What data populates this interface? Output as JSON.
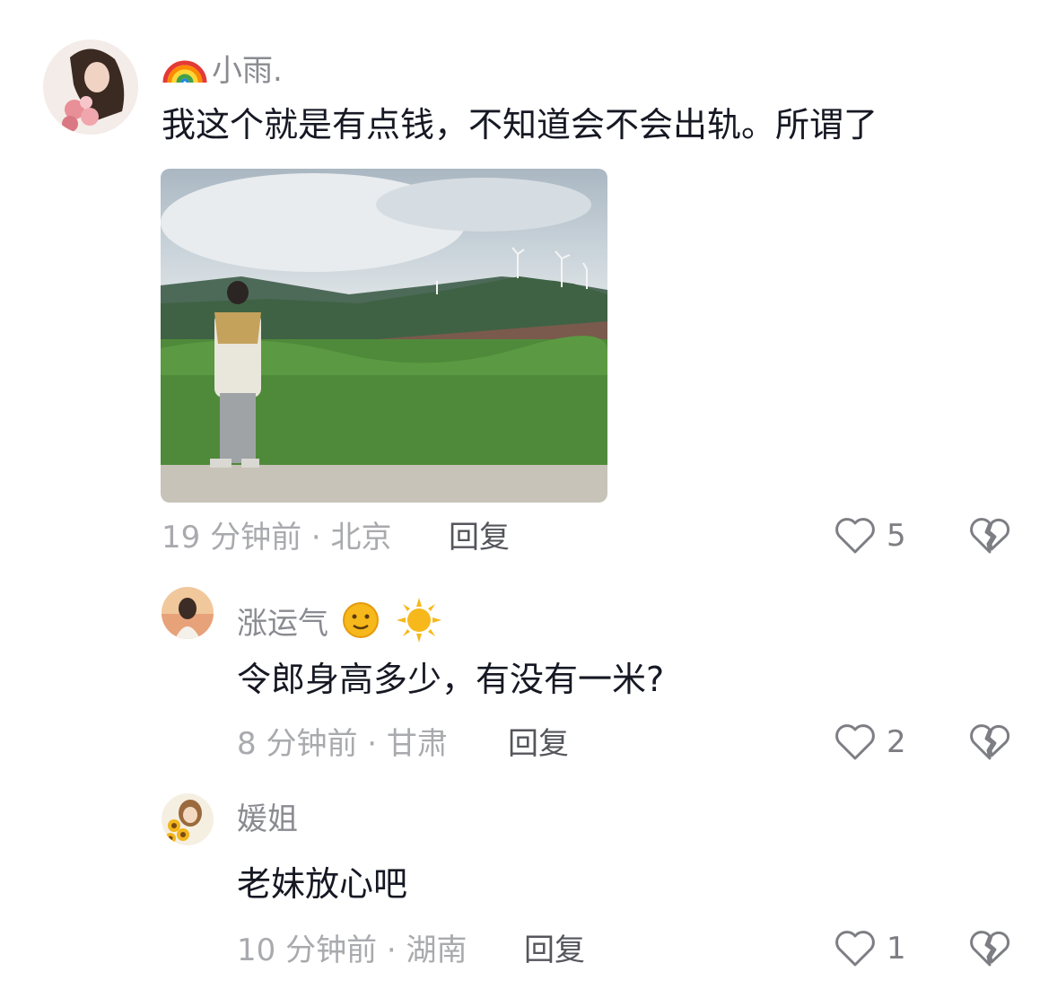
{
  "comments": [
    {
      "name_prefix_icon": "rainbow-icon",
      "name": "小雨.",
      "text": "我这个就是有点钱，不知道会不会出轨。所谓了",
      "image": "photo-man-standing-grassland-wind-turbines",
      "time": "19 分钟前 · 北京",
      "reply_label": "回复",
      "likes": "5"
    },
    {
      "name": "涨运气",
      "name_suffix_icons": [
        "sun-face-icon",
        "sun-icon"
      ],
      "text": "令郎身高多少，有没有一米?",
      "time": "8 分钟前 · 甘肃",
      "reply_label": "回复",
      "likes": "2"
    },
    {
      "name": "媛姐",
      "text": "老妹放心吧",
      "time": "10 分钟前 · 湖南",
      "reply_label": "回复",
      "likes": "1"
    }
  ],
  "colors": {
    "text": "#161823",
    "name": "#8a8b91",
    "meta": "#a9aaae",
    "reply": "#55565c"
  }
}
